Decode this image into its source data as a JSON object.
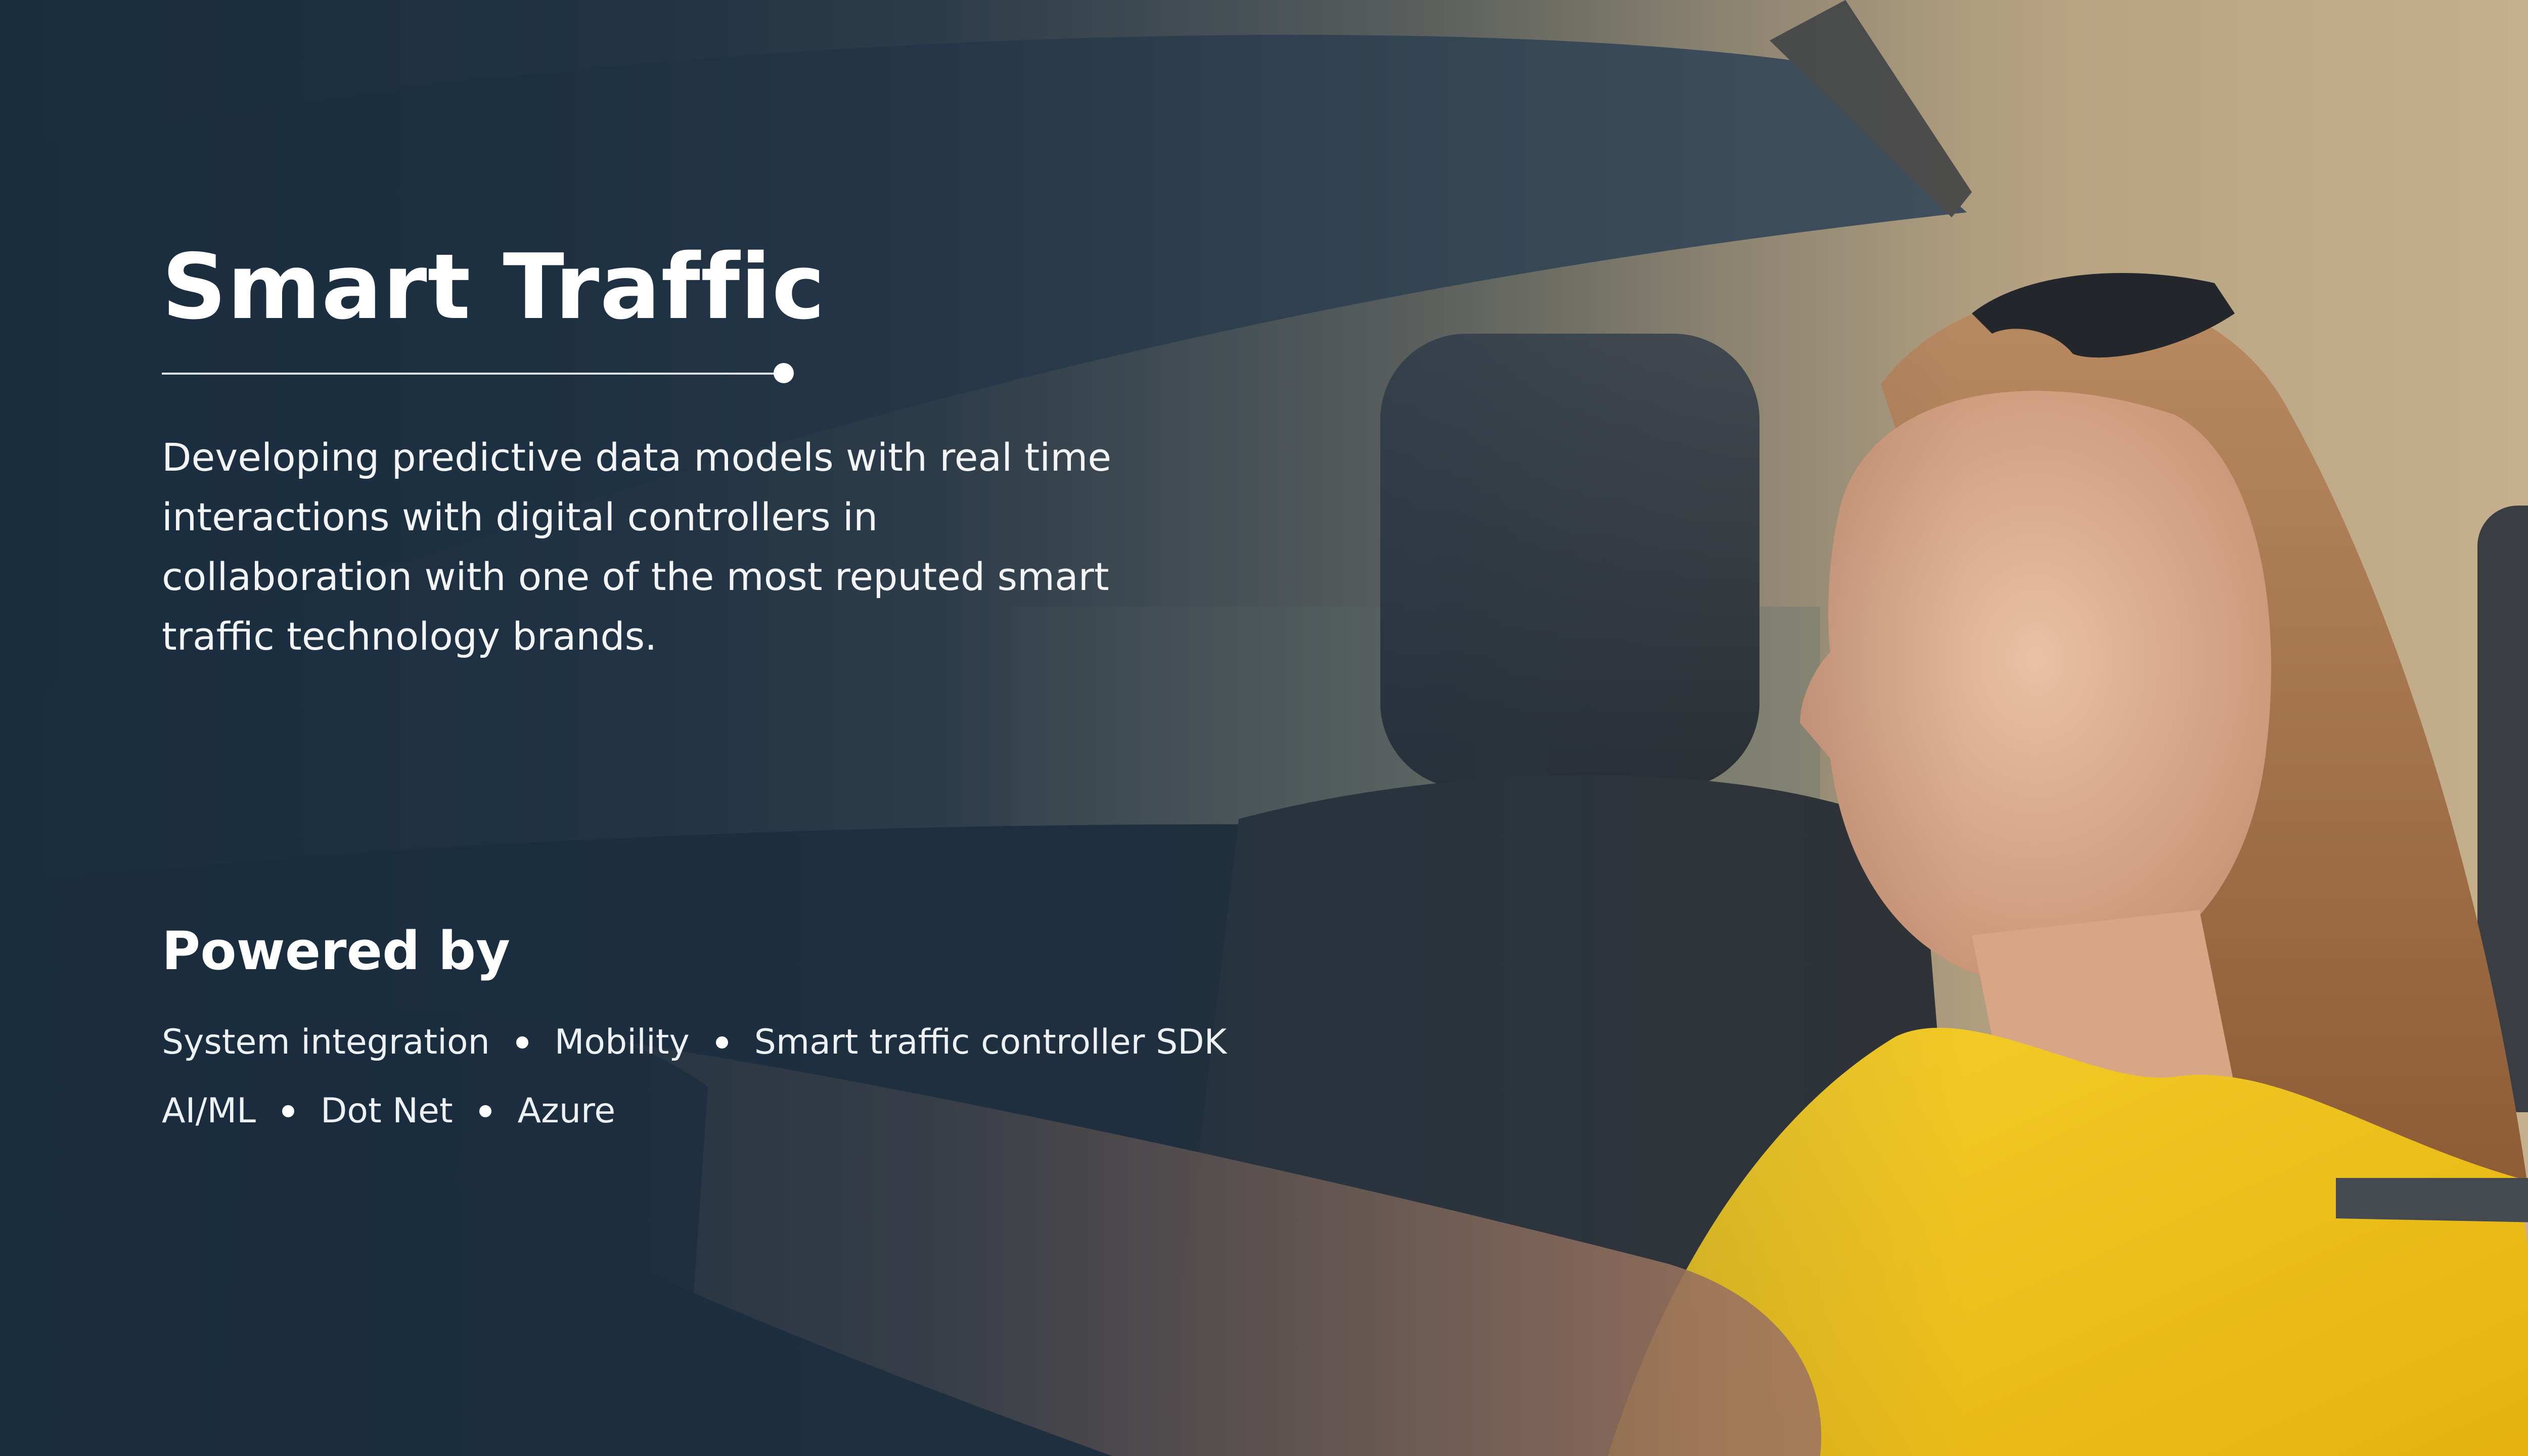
{
  "hero": {
    "title": "Smart Traffic",
    "description": "Developing predictive data models with real time interactions with digital controllers in collaboration with one of the most reputed smart traffic technology brands.",
    "powered_by_heading": "Powered by",
    "tech_rows": [
      [
        "System integration",
        "Mobility",
        "Smart traffic controller SDK"
      ],
      [
        "AI/ML",
        "Dot Net",
        "Azure"
      ]
    ]
  },
  "colors": {
    "overlay": "#1c2e40",
    "text": "#ffffff",
    "shirt": "#f2c21b"
  }
}
